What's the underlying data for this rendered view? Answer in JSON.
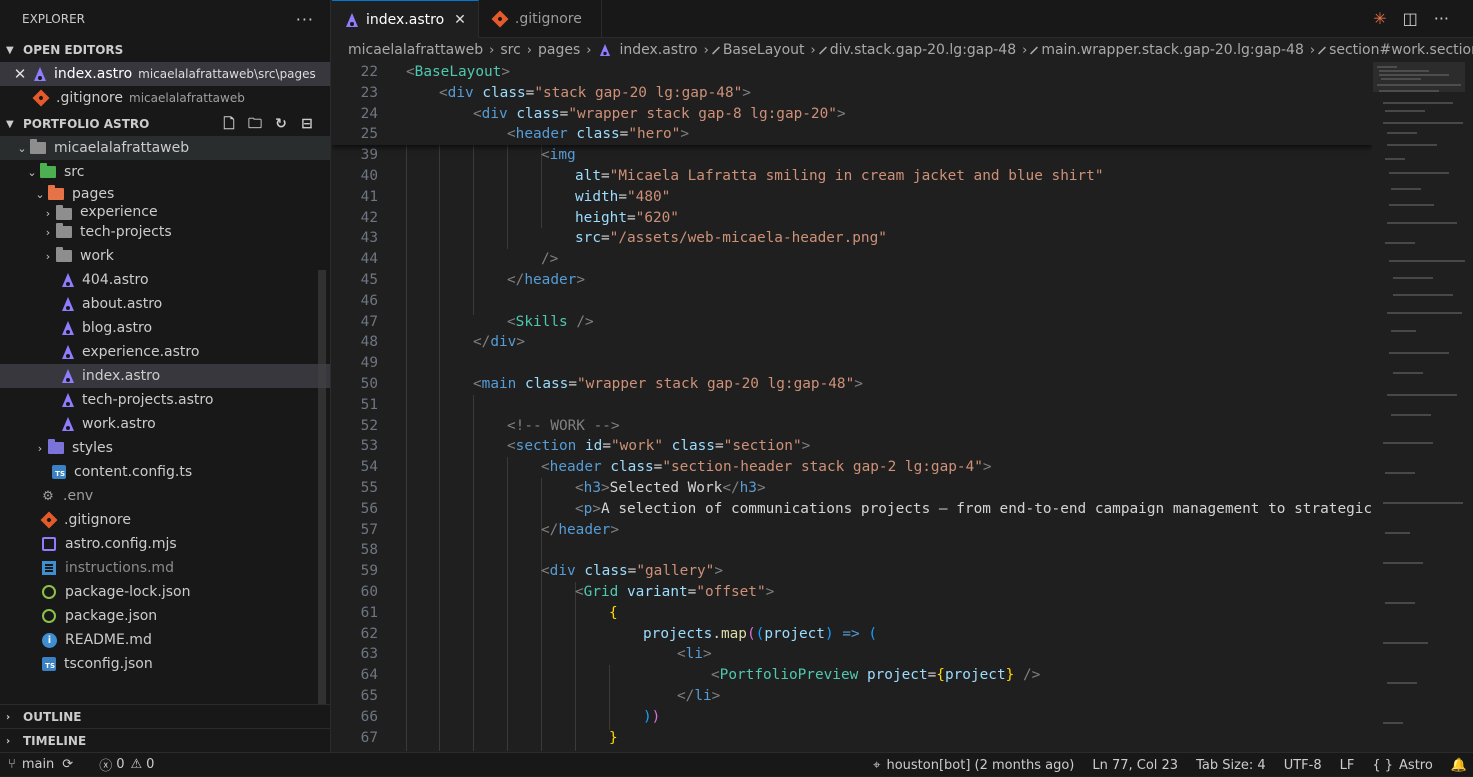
{
  "explorer": {
    "title": "EXPLORER",
    "more": "···",
    "open_editors_label": "OPEN EDITORS",
    "open_editors": [
      {
        "name": "index.astro",
        "desc": "micaelalafrattaweb\\src\\pages",
        "icon": "astro-icon"
      },
      {
        "name": ".gitignore",
        "desc": "micaelalafrattaweb",
        "icon": "git-icon"
      }
    ],
    "project_label": "PORTFOLIO ASTRO",
    "tree": {
      "root": "micaelalafrattaweb",
      "src": "src",
      "pages": "pages",
      "experience_folder": "experience",
      "tech_projects_folder": "tech-projects",
      "work_folder": "work",
      "files_pages": [
        "404.astro",
        "about.astro",
        "blog.astro",
        "experience.astro",
        "index.astro",
        "tech-projects.astro",
        "work.astro"
      ],
      "styles": "styles",
      "content_config": "content.config.ts",
      "env": ".env",
      "gitignore": ".gitignore",
      "astro_config": "astro.config.mjs",
      "instructions": "instructions.md",
      "package_lock": "package-lock.json",
      "package": "package.json",
      "readme": "README.md",
      "tsconfig": "tsconfig.json"
    },
    "outline_label": "OUTLINE",
    "timeline_label": "TIMELINE"
  },
  "tabs": [
    {
      "label": "index.astro",
      "active": true
    },
    {
      "label": ".gitignore",
      "active": false
    }
  ],
  "breadcrumbs": [
    "micaelalafrattaweb",
    "src",
    "pages",
    "index.astro",
    "BaseLayout",
    "div.stack.gap-20.lg:gap-48",
    "main.wrapper.stack.gap-20.lg:gap-48",
    "section#work.section"
  ],
  "code": {
    "sticky_lines": [
      "22",
      "23",
      "24",
      "25"
    ],
    "lines": [
      "39",
      "40",
      "41",
      "42",
      "43",
      "44",
      "45",
      "46",
      "47",
      "48",
      "49",
      "50",
      "51",
      "52",
      "53",
      "54",
      "55",
      "56",
      "57",
      "58",
      "59",
      "60",
      "61",
      "62",
      "63",
      "64",
      "65",
      "66",
      "67"
    ],
    "str": {
      "base_layout": "BaseLayout",
      "div": "div",
      "class": "class",
      "stack_gap": "\"stack gap-20 lg:gap-48\"",
      "wrapper_gap": "\"wrapper stack gap-8 lg:gap-20\"",
      "header": "header",
      "hero": "\"hero\"",
      "img": "img",
      "alt": "alt",
      "alt_val": "\"Micaela Lafratta smiling in cream jacket and blue shirt\"",
      "width": "width",
      "width_val": "\"480\"",
      "height": "height",
      "height_val": "\"620\"",
      "src": "src",
      "src_val": "\"/assets/web-micaela-header.png\"",
      "skills": "Skills",
      "main": "main",
      "main_val": "\"wrapper stack gap-20 lg:gap-48\"",
      "comment": "<!-- WORK -->",
      "section": "section",
      "id": "id",
      "work_val": "\"work\"",
      "section_val": "\"section\"",
      "section_header_val": "\"section-header stack gap-2 lg:gap-4\"",
      "h3": "h3",
      "selected_work": "Selected Work",
      "p": "p",
      "p_text": "A selection of communications projects — from end-to-end campaign management to strategic st",
      "gallery_val": "\"gallery\"",
      "grid": "Grid",
      "variant": "variant",
      "offset_val": "\"offset\"",
      "projects": "projects",
      "map": "map",
      "project": "project",
      "li": "li",
      "portfolio_preview": "PortfolioPreview",
      "project_attr": "project"
    }
  },
  "status": {
    "branch": "main",
    "errors": "0",
    "warnings": "0",
    "blame": "houston[bot] (2 months ago)",
    "position": "Ln 77, Col 23",
    "tab_size": "Tab Size: 4",
    "encoding": "UTF-8",
    "eol": "LF",
    "language": "Astro",
    "language_braces": "{ }"
  },
  "colors": {
    "accent": "#0078d4",
    "astro": "#8e7dff",
    "git": "#e45a2b"
  }
}
